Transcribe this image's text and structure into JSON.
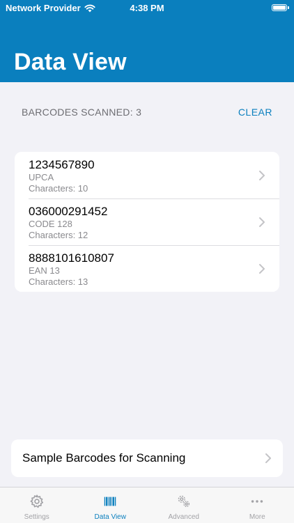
{
  "status_bar": {
    "carrier": "Network Provider",
    "time": "4:38 PM"
  },
  "header": {
    "title": "Data View"
  },
  "summary": {
    "count_label": "BARCODES SCANNED: 3",
    "clear_label": "CLEAR"
  },
  "barcodes": [
    {
      "value": "1234567890",
      "type": "UPCA",
      "characters": "Characters: 10"
    },
    {
      "value": "036000291452",
      "type": "CODE 128",
      "characters": "Characters: 12"
    },
    {
      "value": "8888101610807",
      "type": "EAN 13",
      "characters": "Characters: 13"
    }
  ],
  "sample": {
    "label": "Sample Barcodes for Scanning"
  },
  "tabs": [
    {
      "label": "Settings",
      "icon": "gear-icon"
    },
    {
      "label": "Data View",
      "icon": "barcode-icon"
    },
    {
      "label": "Advanced",
      "icon": "gears-icon"
    },
    {
      "label": "More",
      "icon": "ellipsis-icon"
    }
  ],
  "colors": {
    "accent": "#0a7fbe",
    "background": "#f2f2f7",
    "inactive_tab": "#a2a2a6"
  }
}
